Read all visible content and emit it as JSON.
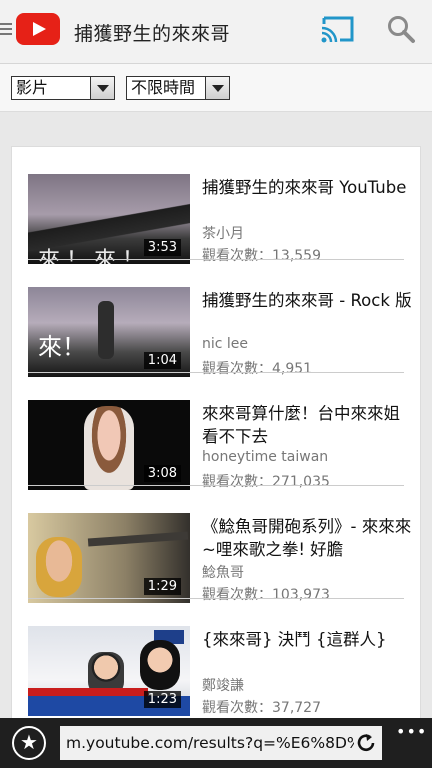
{
  "header": {
    "title": "捕獲野生的來來哥",
    "icons": {
      "menu": "hamburger-icon",
      "logo": "youtube-logo",
      "cast": "cast-icon",
      "search": "search-icon"
    },
    "colors": {
      "logo": "#e62117",
      "cast": "#2196c9"
    }
  },
  "filters": {
    "type_value": "影片",
    "time_value": "不限時間"
  },
  "videos": [
    {
      "title": "捕獲野生的來來哥 YouTube",
      "channel": "茶小月",
      "views": "觀看次數：13,559",
      "duration": "3:53",
      "thumb_caption": "來！來！來！"
    },
    {
      "title": "捕獲野生的來來哥 - Rock 版",
      "channel": "nic lee",
      "views": "觀看次數：4,951",
      "duration": "1:04",
      "thumb_caption": "來！"
    },
    {
      "title": "來來哥算什麼！台中來來姐看不下去",
      "channel": "honeytime taiwan",
      "views": "觀看次數：271,035",
      "duration": "3:08"
    },
    {
      "title": "《鯰魚哥開砲系列》- 來來來~哩來歌之拳! 好膽",
      "channel": "鯰魚哥",
      "views": "觀看次數：103,973",
      "duration": "1:29"
    },
    {
      "title": "{來來哥} 決鬥 {這群人}",
      "channel": "鄭竣謙",
      "views": "觀看次數：37,727",
      "duration": "1:23"
    }
  ],
  "browser": {
    "url": "m.youtube.com/results?q=%E6%8D%",
    "more_label": "•••"
  }
}
